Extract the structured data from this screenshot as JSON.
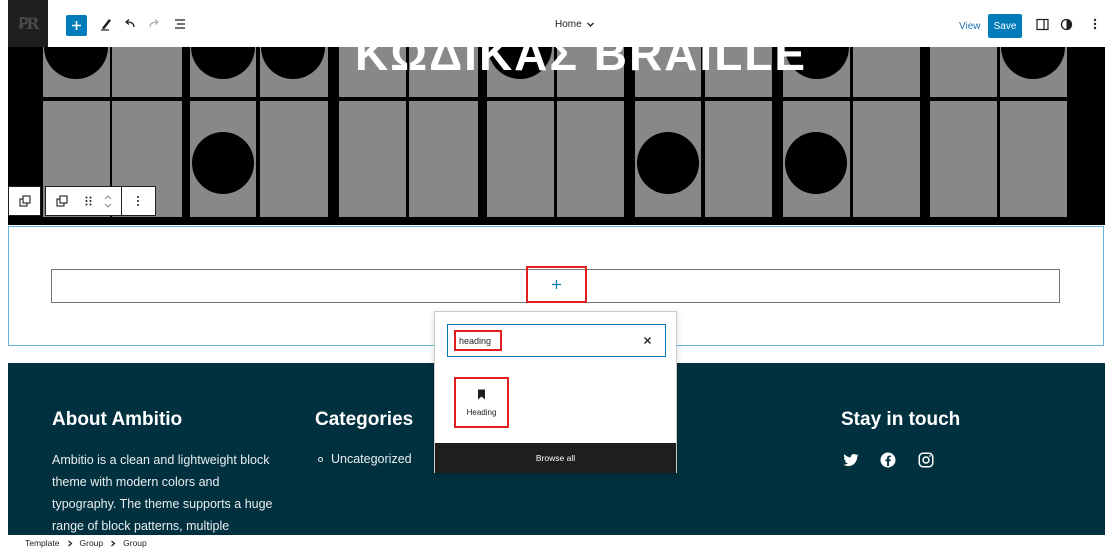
{
  "toolbar": {
    "logo_text": "ꝐR",
    "document_title": "Home",
    "view_label": "View",
    "save_label": "Save"
  },
  "hero": {
    "title": "ΚΩΔΙΚΑΣ BRAILLE"
  },
  "inserter": {
    "search_value": "heading",
    "result_label": "Heading",
    "browse_all_label": "Browse all"
  },
  "footer": {
    "about_heading": "About Ambitio",
    "about_text": "Ambitio is a clean and lightweight block theme with modern colors and typography. The theme supports a huge range of block patterns, multiple",
    "categories_heading": "Categories",
    "category_item": "Uncategorized",
    "stay_heading": "Stay in touch"
  },
  "breadcrumb": {
    "items": [
      "Template",
      "Group",
      "Group"
    ]
  },
  "colors": {
    "accent": "#007cba",
    "highlight": "#e02020",
    "footer_bg": "#01303f"
  }
}
